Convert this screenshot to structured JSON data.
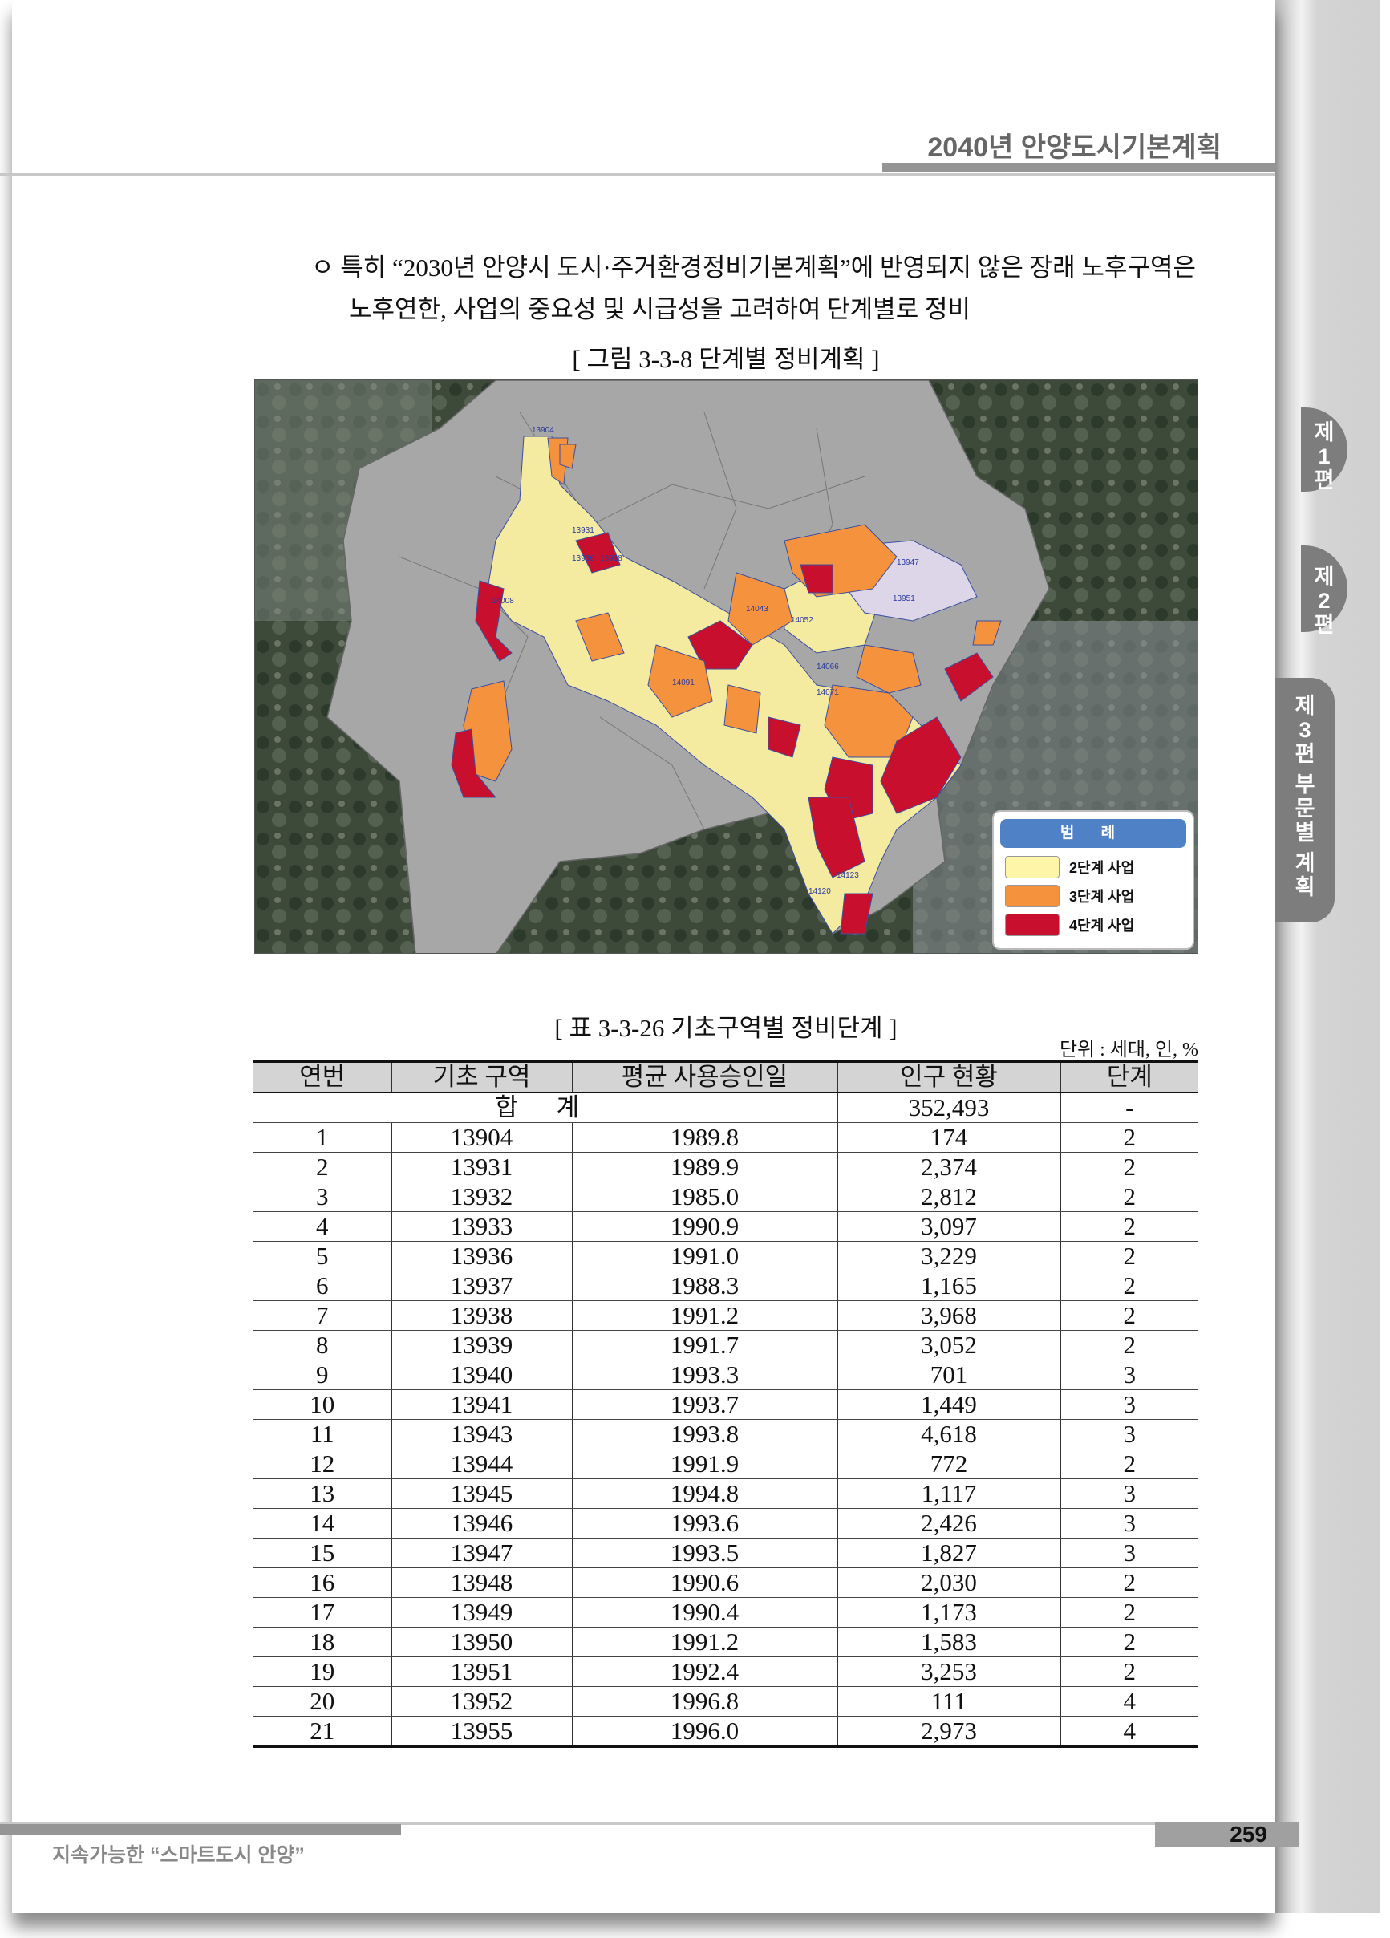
{
  "header": {
    "title": "2040년 안양도시기본계획"
  },
  "side_tabs": [
    {
      "chars": [
        "제",
        "1",
        "편"
      ]
    },
    {
      "chars": [
        "제",
        "2",
        "편"
      ]
    },
    {
      "chars": [
        "제",
        "3",
        "편",
        "부",
        "문",
        "별",
        "계",
        "획"
      ]
    }
  ],
  "body": {
    "bullet_line1": "ㅇ 특히 “2030년 안양시 도시·주거환경정비기본계획”에 반영되지 않은 장래 노후구역은",
    "bullet_line2": "노후연한, 사업의 중요성 및 시급성을 고려하여 단계별로 정비"
  },
  "figure": {
    "caption": "[ 그림 3-3-8 단계별 정비계획 ]",
    "zone_labels": [
      "13904",
      "13931",
      "13936",
      "13938",
      "13947",
      "13951",
      "14008",
      "14043",
      "14052",
      "14066",
      "14071",
      "14091",
      "14120",
      "14123"
    ],
    "legend": {
      "title": "범 례",
      "items": [
        {
          "label": "2단계 사업",
          "color": "#fff5a8"
        },
        {
          "label": "3단계 사업",
          "color": "#f5923e"
        },
        {
          "label": "4단계 사업",
          "color": "#c8102e"
        }
      ]
    }
  },
  "table": {
    "caption": "[ 표 3-3-26 기초구역별 정비단계 ]",
    "unit": "단위 : 세대, 인, %",
    "headers": [
      "연번",
      "기초 구역",
      "평균 사용승인일",
      "인구 현황",
      "단계"
    ],
    "total": {
      "label": "합 계",
      "population": "352,493",
      "stage": "-"
    },
    "rows": [
      [
        "1",
        "13904",
        "1989.8",
        "174",
        "2"
      ],
      [
        "2",
        "13931",
        "1989.9",
        "2,374",
        "2"
      ],
      [
        "3",
        "13932",
        "1985.0",
        "2,812",
        "2"
      ],
      [
        "4",
        "13933",
        "1990.9",
        "3,097",
        "2"
      ],
      [
        "5",
        "13936",
        "1991.0",
        "3,229",
        "2"
      ],
      [
        "6",
        "13937",
        "1988.3",
        "1,165",
        "2"
      ],
      [
        "7",
        "13938",
        "1991.2",
        "3,968",
        "2"
      ],
      [
        "8",
        "13939",
        "1991.7",
        "3,052",
        "2"
      ],
      [
        "9",
        "13940",
        "1993.3",
        "701",
        "3"
      ],
      [
        "10",
        "13941",
        "1993.7",
        "1,449",
        "3"
      ],
      [
        "11",
        "13943",
        "1993.8",
        "4,618",
        "3"
      ],
      [
        "12",
        "13944",
        "1991.9",
        "772",
        "2"
      ],
      [
        "13",
        "13945",
        "1994.8",
        "1,117",
        "3"
      ],
      [
        "14",
        "13946",
        "1993.6",
        "2,426",
        "3"
      ],
      [
        "15",
        "13947",
        "1993.5",
        "1,827",
        "3"
      ],
      [
        "16",
        "13948",
        "1990.6",
        "2,030",
        "2"
      ],
      [
        "17",
        "13949",
        "1990.4",
        "1,173",
        "2"
      ],
      [
        "18",
        "13950",
        "1991.2",
        "1,583",
        "2"
      ],
      [
        "19",
        "13951",
        "1992.4",
        "3,253",
        "2"
      ],
      [
        "20",
        "13952",
        "1996.8",
        "111",
        "4"
      ],
      [
        "21",
        "13955",
        "1996.0",
        "2,973",
        "4"
      ]
    ]
  },
  "footer": {
    "text": "지속가능한 “스마트도시 안양”",
    "page_number": "259"
  }
}
